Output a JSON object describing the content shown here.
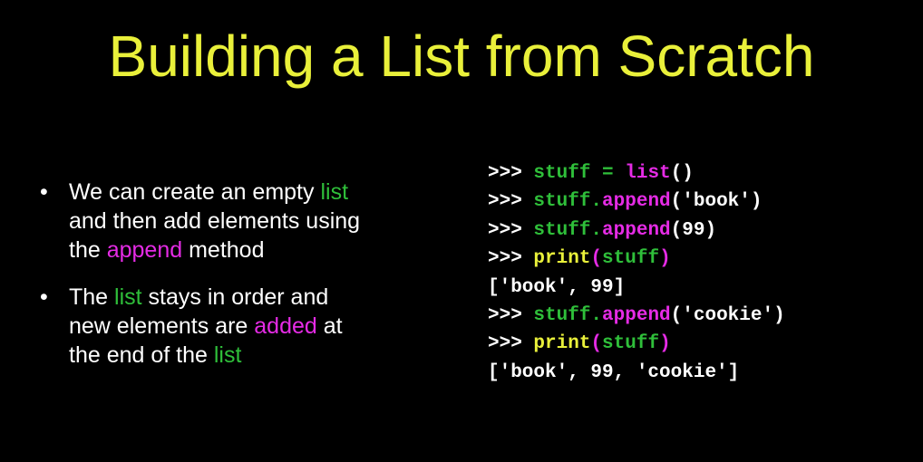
{
  "colors": {
    "title": "#e9f03a",
    "text": "#ffffff",
    "green": "#2fbf3a",
    "magenta": "#e52be5",
    "yellow": "#e9f03a",
    "background": "#000000"
  },
  "title": "Building a List from Scratch",
  "bullet_marker": "•",
  "bullets": [
    {
      "segments": [
        {
          "text": "We can create an empty ",
          "color": "text"
        },
        {
          "text": "list",
          "color": "green"
        },
        {
          "text": "\nand then add elements using\nthe ",
          "color": "text"
        },
        {
          "text": "append",
          "color": "magenta"
        },
        {
          "text": " method",
          "color": "text"
        }
      ]
    },
    {
      "segments": [
        {
          "text": "The ",
          "color": "text"
        },
        {
          "text": "list",
          "color": "green"
        },
        {
          "text": " stays in order and\nnew elements are ",
          "color": "text"
        },
        {
          "text": "added",
          "color": "magenta"
        },
        {
          "text": " at\nthe end of the ",
          "color": "text"
        },
        {
          "text": "list",
          "color": "green"
        }
      ]
    }
  ],
  "code_lines": [
    [
      {
        "text": ">>> ",
        "color": "text"
      },
      {
        "text": "stuff",
        "color": "green"
      },
      {
        "text": " ",
        "color": "text"
      },
      {
        "text": "=",
        "color": "green"
      },
      {
        "text": " ",
        "color": "text"
      },
      {
        "text": "list",
        "color": "magenta"
      },
      {
        "text": "()",
        "color": "text"
      }
    ],
    [
      {
        "text": ">>> ",
        "color": "text"
      },
      {
        "text": "stuff.",
        "color": "green"
      },
      {
        "text": "append",
        "color": "magenta"
      },
      {
        "text": "('book')",
        "color": "text"
      }
    ],
    [
      {
        "text": ">>> ",
        "color": "text"
      },
      {
        "text": "stuff.",
        "color": "green"
      },
      {
        "text": "append",
        "color": "magenta"
      },
      {
        "text": "(99)",
        "color": "text"
      }
    ],
    [
      {
        "text": ">>> ",
        "color": "text"
      },
      {
        "text": "print",
        "color": "yellow"
      },
      {
        "text": "(",
        "color": "magenta"
      },
      {
        "text": "stuff",
        "color": "green"
      },
      {
        "text": ")",
        "color": "magenta"
      }
    ],
    [
      {
        "text": "['book', 99]",
        "color": "text"
      }
    ],
    [
      {
        "text": ">>> ",
        "color": "text"
      },
      {
        "text": "stuff.",
        "color": "green"
      },
      {
        "text": "append",
        "color": "magenta"
      },
      {
        "text": "('cookie')",
        "color": "text"
      }
    ],
    [
      {
        "text": ">>> ",
        "color": "text"
      },
      {
        "text": "print",
        "color": "yellow"
      },
      {
        "text": "(",
        "color": "magenta"
      },
      {
        "text": "stuff",
        "color": "green"
      },
      {
        "text": ")",
        "color": "magenta"
      }
    ],
    [
      {
        "text": "['book', 99, 'cookie']",
        "color": "text"
      }
    ]
  ]
}
